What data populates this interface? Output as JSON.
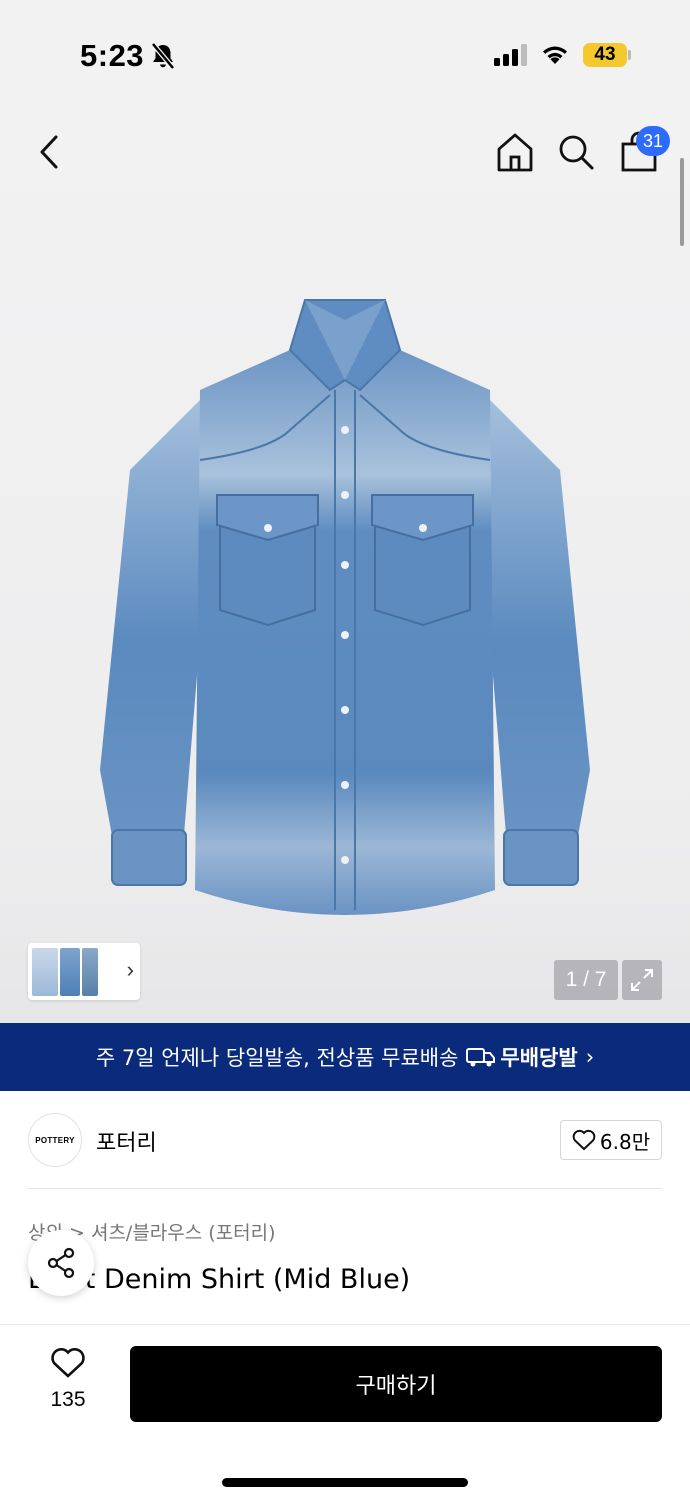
{
  "status_bar": {
    "time": "5:23",
    "battery": "43"
  },
  "header": {
    "cart_count": "31"
  },
  "gallery": {
    "counter": "1 / 7"
  },
  "banner": {
    "text": "주 7일 언제나 당일발송, 전상품 무료배송",
    "brand": "무배당발",
    "arrow": "›"
  },
  "brand": {
    "logo_text": "POTTERY",
    "name": "포터리",
    "likes": "6.8만"
  },
  "product": {
    "breadcrumb": "상의 > 셔츠/블라우스 (포터리)",
    "title": "Light Denim Shirt (Mid Blue)"
  },
  "bottom": {
    "wish_count": "135",
    "buy_label": "구매하기"
  },
  "colors": {
    "accent_blue": "#2d6bff",
    "banner_navy": "#0a2a7c",
    "battery_yellow": "#f4c92c"
  }
}
